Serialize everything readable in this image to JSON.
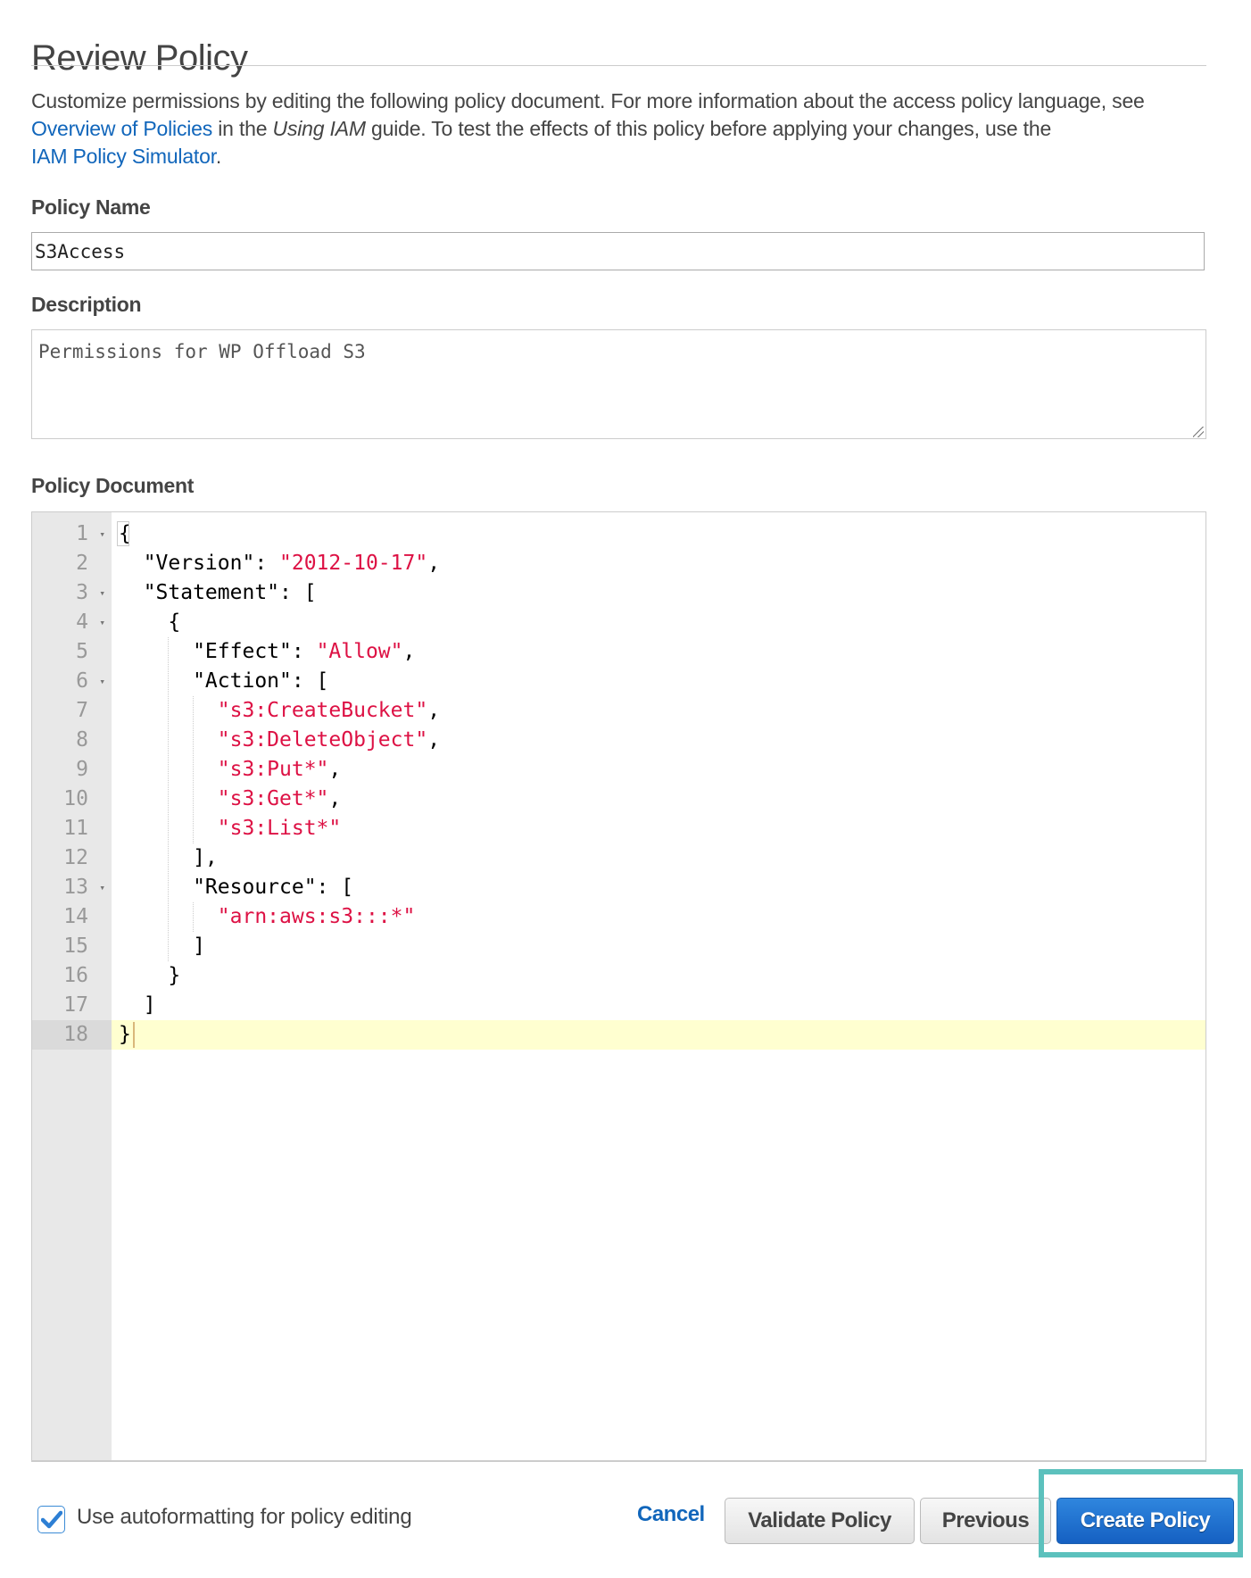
{
  "page": {
    "title": "Review Policy",
    "intro": {
      "text_1": "Customize permissions by editing the following policy document. For more information about the access policy language, see ",
      "link_overview": "Overview of Policies",
      "text_2": " in the ",
      "guide_name": "Using IAM",
      "text_3": " guide. To test the effects of this policy before applying your changes, use the ",
      "link_simulator": "IAM Policy Simulator",
      "text_4": "."
    }
  },
  "form": {
    "policy_name_label": "Policy Name",
    "policy_name_value": "S3Access",
    "description_label": "Description",
    "description_value": "Permissions for WP Offload S3",
    "policy_document_label": "Policy Document"
  },
  "editor": {
    "active_line": 18,
    "lines": [
      {
        "n": "1",
        "fold": true,
        "parts": [
          {
            "t": "{"
          }
        ]
      },
      {
        "n": "2",
        "fold": false,
        "parts": [
          {
            "t": "  \"Version\": "
          },
          {
            "t": "\"2012-10-17\"",
            "s": true
          },
          {
            "t": ","
          }
        ]
      },
      {
        "n": "3",
        "fold": true,
        "parts": [
          {
            "t": "  \"Statement\": ["
          }
        ]
      },
      {
        "n": "4",
        "fold": true,
        "parts": [
          {
            "t": "    {"
          }
        ]
      },
      {
        "n": "5",
        "fold": false,
        "parts": [
          {
            "t": "      \"Effect\": "
          },
          {
            "t": "\"Allow\"",
            "s": true
          },
          {
            "t": ","
          }
        ]
      },
      {
        "n": "6",
        "fold": true,
        "parts": [
          {
            "t": "      \"Action\": ["
          }
        ]
      },
      {
        "n": "7",
        "fold": false,
        "parts": [
          {
            "t": "        "
          },
          {
            "t": "\"s3:CreateBucket\"",
            "s": true
          },
          {
            "t": ","
          }
        ]
      },
      {
        "n": "8",
        "fold": false,
        "parts": [
          {
            "t": "        "
          },
          {
            "t": "\"s3:DeleteObject\"",
            "s": true
          },
          {
            "t": ","
          }
        ]
      },
      {
        "n": "9",
        "fold": false,
        "parts": [
          {
            "t": "        "
          },
          {
            "t": "\"s3:Put*\"",
            "s": true
          },
          {
            "t": ","
          }
        ]
      },
      {
        "n": "10",
        "fold": false,
        "parts": [
          {
            "t": "        "
          },
          {
            "t": "\"s3:Get*\"",
            "s": true
          },
          {
            "t": ","
          }
        ]
      },
      {
        "n": "11",
        "fold": false,
        "parts": [
          {
            "t": "        "
          },
          {
            "t": "\"s3:List*\"",
            "s": true
          }
        ]
      },
      {
        "n": "12",
        "fold": false,
        "parts": [
          {
            "t": "      ],"
          }
        ]
      },
      {
        "n": "13",
        "fold": true,
        "parts": [
          {
            "t": "      \"Resource\": ["
          }
        ]
      },
      {
        "n": "14",
        "fold": false,
        "parts": [
          {
            "t": "        "
          },
          {
            "t": "\"arn:aws:s3:::*\"",
            "s": true
          }
        ]
      },
      {
        "n": "15",
        "fold": false,
        "parts": [
          {
            "t": "      ]"
          }
        ]
      },
      {
        "n": "16",
        "fold": false,
        "parts": [
          {
            "t": "    }"
          }
        ]
      },
      {
        "n": "17",
        "fold": false,
        "parts": [
          {
            "t": "  ]"
          }
        ]
      },
      {
        "n": "18",
        "fold": false,
        "parts": [
          {
            "t": "}"
          }
        ]
      }
    ]
  },
  "footer": {
    "autoformat_label": "Use autoformatting for policy editing",
    "autoformat_checked": true,
    "cancel_label": "Cancel",
    "validate_label": "Validate Policy",
    "previous_label": "Previous",
    "create_label": "Create Policy"
  },
  "colors": {
    "link": "#1166bb",
    "string": "#dd1144",
    "primary_button": "#1f6fcf",
    "highlight_box": "#5cc1bd",
    "active_line": "#ffffd0"
  }
}
